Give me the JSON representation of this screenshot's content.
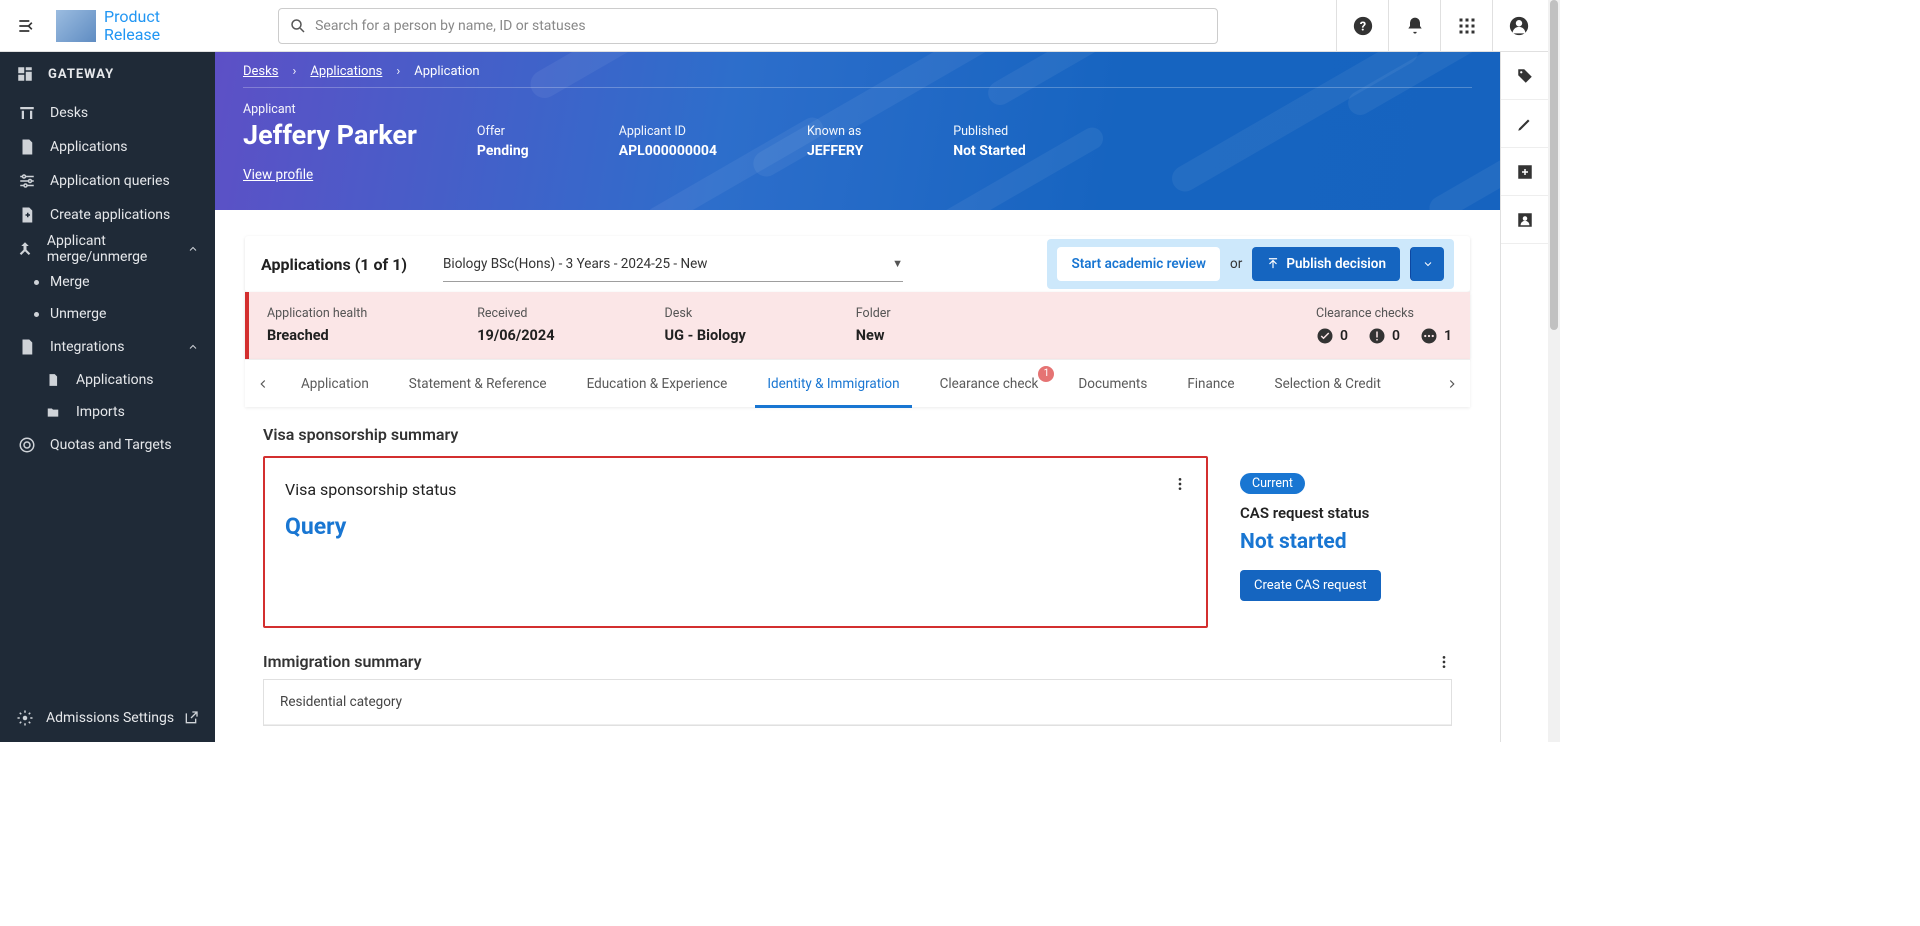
{
  "brand": {
    "line1": "Product",
    "line2": "Release"
  },
  "search": {
    "placeholder": "Search for a person by name, ID or statuses"
  },
  "sidebar": {
    "heading": "GATEWAY",
    "items": [
      "Desks",
      "Applications",
      "Application queries",
      "Create applications",
      "Applicant merge/unmerge"
    ],
    "merge_sub": [
      "Merge",
      "Unmerge"
    ],
    "integrations": "Integrations",
    "integrations_sub": [
      "Applications",
      "Imports"
    ],
    "quotas": "Quotas and Targets",
    "footer": "Admissions Settings"
  },
  "breadcrumb": {
    "desks": "Desks",
    "applications": "Applications",
    "application": "Application"
  },
  "applicant": {
    "label": "Applicant",
    "name": "Jeffery Parker",
    "view_profile": "View profile",
    "offer_label": "Offer",
    "offer_value": "Pending",
    "id_label": "Applicant ID",
    "id_value": "APL000000004",
    "known_label": "Known as",
    "known_value": "JEFFERY",
    "pub_label": "Published",
    "pub_value": "Not Started"
  },
  "apps_bar": {
    "title": "Applications (1 of 1)",
    "select": "Biology BSc(Hons) - 3 Years - 2024-25 - New",
    "review_btn": "Start academic review",
    "or": "or",
    "publish_btn": "Publish decision"
  },
  "health": {
    "h1_label": "Application health",
    "h1_value": "Breached",
    "h2_label": "Received",
    "h2_value": "19/06/2024",
    "h3_label": "Desk",
    "h3_value": "UG - Biology",
    "h4_label": "Folder",
    "h4_value": "New",
    "h5_label": "Clearance checks",
    "c1": "0",
    "c2": "0",
    "c3": "1"
  },
  "tabs": [
    "Application",
    "Statement & Reference",
    "Education & Experience",
    "Identity & Immigration",
    "Clearance check",
    "Documents",
    "Finance",
    "Selection & Credit"
  ],
  "tab_badge": "1",
  "visa": {
    "section_title": "Visa sponsorship summary",
    "status_label": "Visa sponsorship status",
    "status_value": "Query",
    "current_pill": "Current",
    "cas_title": "CAS request status",
    "cas_value": "Not started",
    "cas_btn": "Create CAS request"
  },
  "imm": {
    "title": "Immigration summary",
    "row1": "Residential category"
  }
}
